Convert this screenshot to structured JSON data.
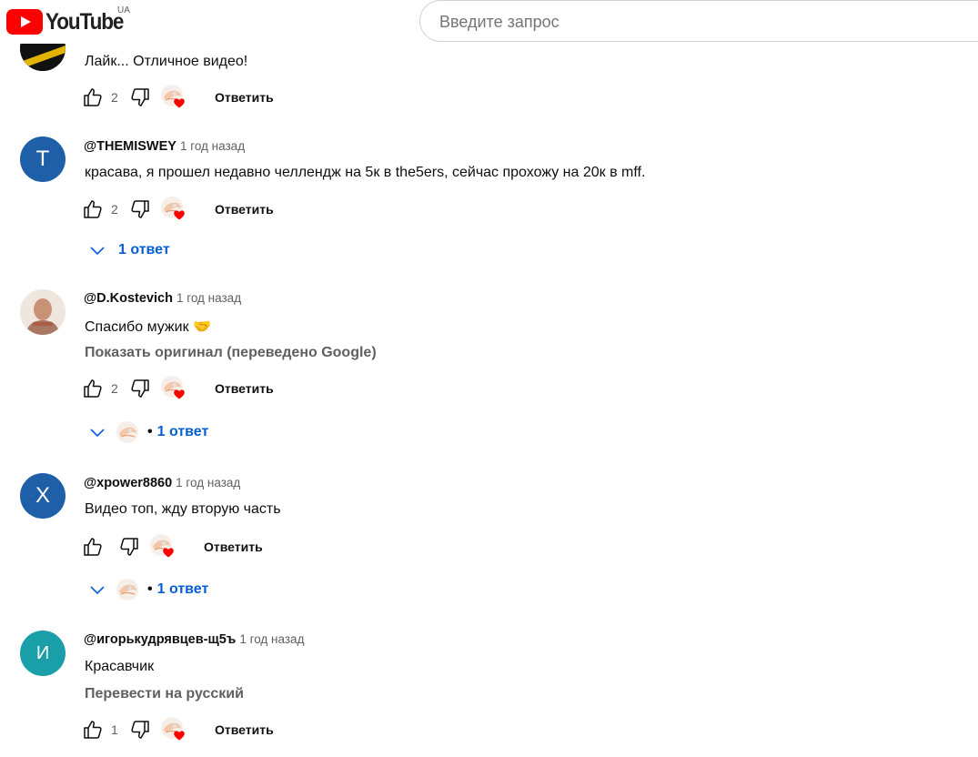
{
  "header": {
    "logo_text": "YouTube",
    "country_code": "UA",
    "search_placeholder": "Введите запрос"
  },
  "comments": [
    {
      "text": "Лайк... Отличное видео!",
      "likes": "2",
      "reply_label": "Ответить"
    },
    {
      "avatar_letter": "T",
      "avatar_color": "#1e5fa8",
      "author": "@THEMISWEY",
      "time": "1 год назад",
      "text": "красава, я прошел недавно челлендж на 5к в the5ers, сейчас прохожу на 20к в mff.",
      "likes": "2",
      "reply_label": "Ответить",
      "replies_label": "1 ответ"
    },
    {
      "author": "@D.Kostevich",
      "time": "1 год назад",
      "text": "Спасибо мужик 🤝",
      "translate_label": "Показать оригинал (переведено Google)",
      "likes": "2",
      "reply_label": "Ответить",
      "replies_dot": "•",
      "replies_label": "1 ответ"
    },
    {
      "avatar_letter": "X",
      "avatar_color": "#1e5fa8",
      "author": "@xpower8860",
      "time": "1 год назад",
      "text": "Видео топ, жду вторую часть",
      "reply_label": "Ответить",
      "replies_dot": "•",
      "replies_label": "1 ответ"
    },
    {
      "avatar_letter": "И",
      "avatar_color": "#1a9fa8",
      "author": "@игорькудрявцев-щ5ъ",
      "time": "1 год назад",
      "text": "Красавчик",
      "translate_label": "Перевести на русский",
      "likes": "1",
      "reply_label": "Ответить"
    }
  ]
}
